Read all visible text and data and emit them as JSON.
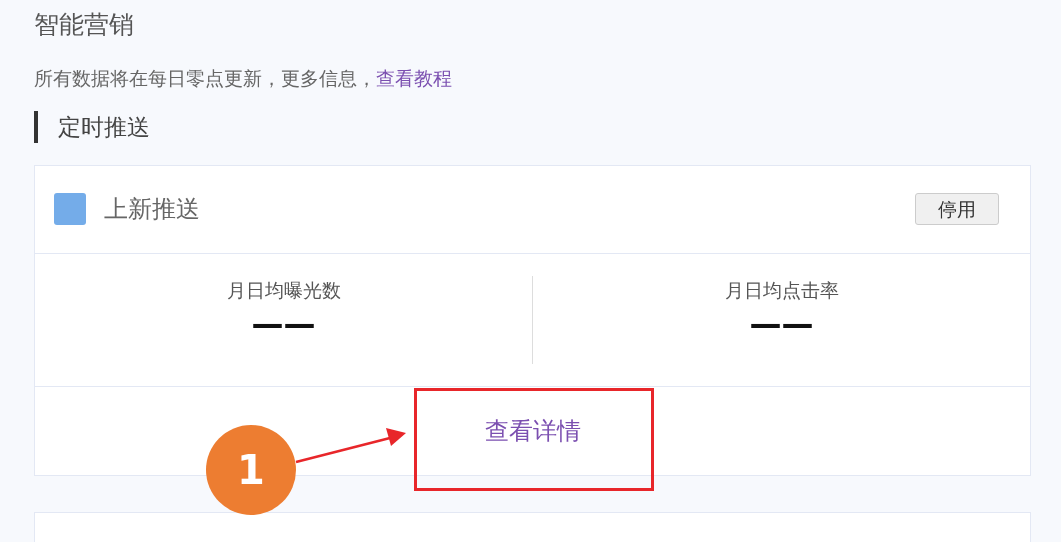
{
  "page": {
    "title": "智能营销",
    "notice": "所有数据将在每日零点更新，更多信息，",
    "notice_link": "查看教程"
  },
  "section": {
    "title": "定时推送"
  },
  "cards": [
    {
      "title": "上新推送",
      "color": "#74ace9",
      "button": "停用",
      "stats": [
        {
          "label": "月日均曝光数",
          "value": "——"
        },
        {
          "label": "月日均点击率",
          "value": "——"
        }
      ],
      "link": "查看详情"
    }
  ],
  "annotation": {
    "number": "1"
  }
}
